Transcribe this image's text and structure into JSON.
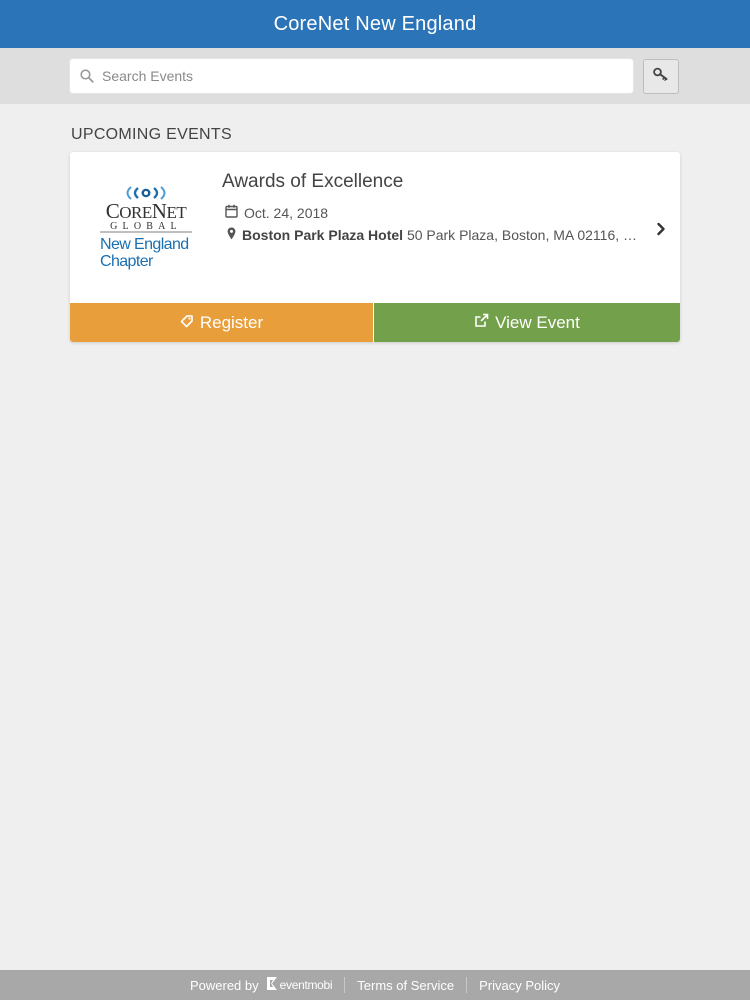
{
  "header": {
    "title": "CoreNet New England"
  },
  "search": {
    "placeholder": "Search Events",
    "value": ""
  },
  "section": {
    "heading": "UPCOMING EVENTS"
  },
  "event": {
    "title": "Awards of Excellence",
    "date": "Oct. 24, 2018",
    "location_name": "Boston Park Plaza Hotel",
    "location_address": "50 Park Plaza, Boston, MA 02116, U...",
    "logo": {
      "line1": "CoreNet",
      "line2": "GLOBAL",
      "line3": "New England",
      "line4": "Chapter"
    },
    "register_label": "Register",
    "view_label": "View Event"
  },
  "footer": {
    "powered_by": "Powered by",
    "brand": "eventmobi",
    "terms": "Terms of Service",
    "privacy": "Privacy Policy"
  },
  "colors": {
    "header": "#2c74b8",
    "register": "#e99e3c",
    "view_event": "#72a04b",
    "background": "#efefef",
    "footer": "#a8a8a8"
  },
  "icons": [
    "search-icon",
    "key-icon",
    "calendar-icon",
    "map-pin-icon",
    "chevron-right-icon",
    "tag-icon",
    "external-link-icon",
    "eventmobi-logo-icon"
  ]
}
